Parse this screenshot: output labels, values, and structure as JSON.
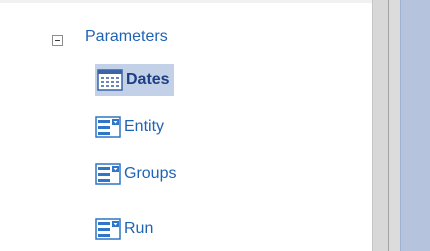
{
  "tree": {
    "root": {
      "label": "Parameters",
      "expander_icon": "minus-box-icon"
    },
    "items": [
      {
        "label": "Dates",
        "icon": "calendar-icon",
        "selected": true
      },
      {
        "label": "Entity",
        "icon": "list-dropdown-icon",
        "selected": false
      },
      {
        "label": "Groups",
        "icon": "list-dropdown-icon",
        "selected": false
      },
      {
        "label": "Run",
        "icon": "list-dropdown-icon",
        "selected": false
      }
    ]
  },
  "colors": {
    "label_text": "#1f63b5",
    "selected_background": "#c3d1e8",
    "icon_blue": "#2f75c8",
    "splitter": "#d8d8d8",
    "right_panel": "#b6c3dc"
  }
}
